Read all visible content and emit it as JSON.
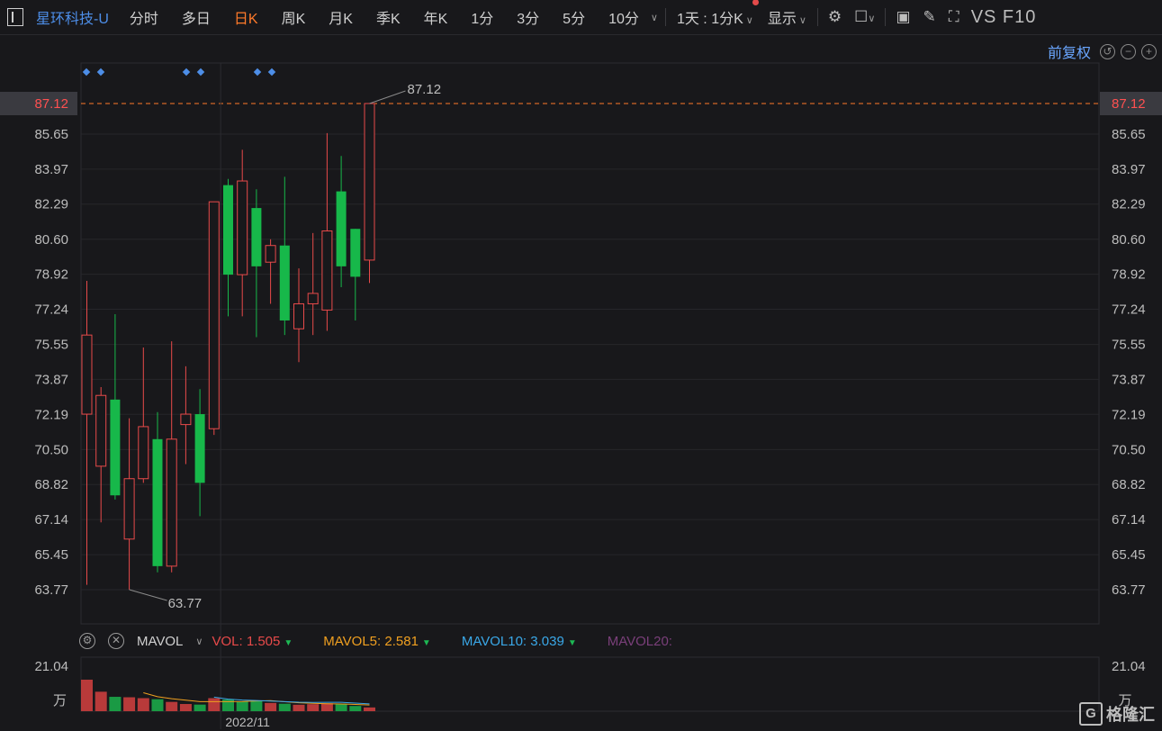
{
  "header": {
    "symbol": "星环科技-U",
    "periods": [
      "分时",
      "多日",
      "日K",
      "周K",
      "月K",
      "季K",
      "年K",
      "1分",
      "3分",
      "5分",
      "10分"
    ],
    "active_period": "日K",
    "interval_select": "1天 : 1分K",
    "display_label": "显示",
    "vs_f10": "VS F10"
  },
  "chart_toolbar": {
    "adjust_label": "前复权"
  },
  "volume_header": {
    "indicator": "MAVOL",
    "vol_label": "VOL:",
    "vol_value": "1.505",
    "mavol5_label": "MAVOL5:",
    "mavol5_value": "2.581",
    "mavol10_label": "MAVOL10:",
    "mavol10_value": "3.039",
    "mavol20_label": "MAVOL20:"
  },
  "watermark": "格隆汇",
  "colors": {
    "up": "#e84a4a",
    "down": "#17b84a",
    "accent": "#ff7a2a",
    "link": "#4d8ee8",
    "mavol5": "#f0a020",
    "mavol10": "#3aa8e8"
  },
  "chart_data": {
    "type": "candlestick",
    "y_ticks": [
      87.12,
      85.65,
      83.97,
      82.29,
      80.6,
      78.92,
      77.24,
      75.55,
      73.87,
      72.19,
      70.5,
      68.82,
      67.14,
      65.45,
      63.77
    ],
    "y_range": [
      63.77,
      87.12
    ],
    "high_label": "87.12",
    "low_label": "63.77",
    "current_price": "87.12",
    "x_label": "2022/11",
    "candles": [
      {
        "o": 72.2,
        "c": 76.0,
        "h": 78.6,
        "l": 64.0
      },
      {
        "o": 69.7,
        "c": 73.1,
        "h": 73.5,
        "l": 67.0
      },
      {
        "o": 72.9,
        "c": 68.3,
        "h": 77.0,
        "l": 68.1
      },
      {
        "o": 66.2,
        "c": 69.1,
        "h": 72.0,
        "l": 63.77
      },
      {
        "o": 69.1,
        "c": 71.6,
        "h": 75.4,
        "l": 68.9
      },
      {
        "o": 71.0,
        "c": 64.9,
        "h": 72.3,
        "l": 64.6
      },
      {
        "o": 64.9,
        "c": 71.0,
        "h": 75.7,
        "l": 64.6
      },
      {
        "o": 71.7,
        "c": 72.2,
        "h": 74.5,
        "l": 69.8
      },
      {
        "o": 72.2,
        "c": 68.9,
        "h": 73.4,
        "l": 67.3
      },
      {
        "o": 71.5,
        "c": 82.4,
        "h": 82.4,
        "l": 71.2
      },
      {
        "o": 83.2,
        "c": 78.9,
        "h": 83.5,
        "l": 76.9
      },
      {
        "o": 78.9,
        "c": 83.4,
        "h": 84.9,
        "l": 76.9
      },
      {
        "o": 82.1,
        "c": 79.3,
        "h": 83.0,
        "l": 75.9
      },
      {
        "o": 79.5,
        "c": 80.3,
        "h": 80.6,
        "l": 77.5
      },
      {
        "o": 80.3,
        "c": 76.7,
        "h": 83.6,
        "l": 76.0
      },
      {
        "o": 76.3,
        "c": 77.5,
        "h": 79.2,
        "l": 74.7
      },
      {
        "o": 77.5,
        "c": 78.0,
        "h": 80.9,
        "l": 76.0
      },
      {
        "o": 77.2,
        "c": 81.0,
        "h": 85.7,
        "l": 76.2
      },
      {
        "o": 82.9,
        "c": 79.3,
        "h": 84.6,
        "l": 78.3
      },
      {
        "o": 81.1,
        "c": 78.8,
        "h": 81.1,
        "l": 76.7
      },
      {
        "o": 79.6,
        "c": 87.12,
        "h": 87.12,
        "l": 78.5
      }
    ],
    "volume": {
      "y_tick": "21.04",
      "unit": "万",
      "values": [
        21.04,
        13.0,
        9.6,
        9.3,
        8.7,
        8.0,
        6.2,
        4.8,
        4.4,
        8.7,
        7.8,
        6.6,
        6.7,
        5.5,
        5.0,
        4.3,
        4.7,
        5.3,
        4.8,
        3.5,
        2.5
      ],
      "up": [
        true,
        true,
        false,
        true,
        true,
        false,
        true,
        true,
        false,
        true,
        false,
        false,
        false,
        true,
        false,
        true,
        true,
        true,
        false,
        false,
        true
      ]
    }
  }
}
